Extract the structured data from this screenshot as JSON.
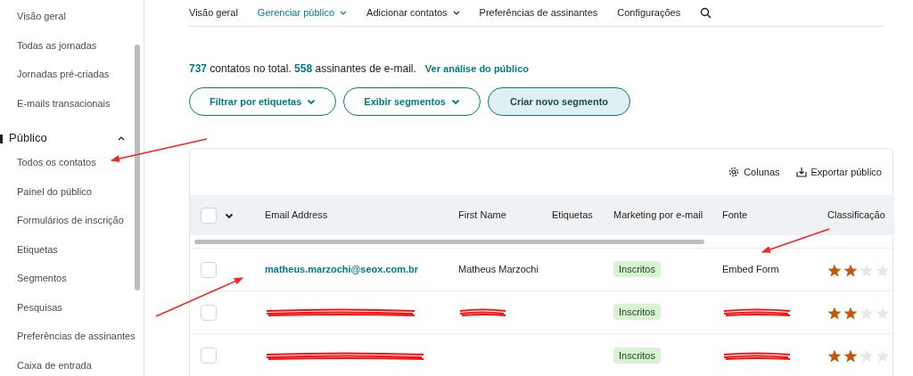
{
  "sidebar": {
    "items": [
      {
        "label": "Visão geral",
        "selected": false
      },
      {
        "label": "Todas as jornadas",
        "selected": false
      },
      {
        "label": "Jornadas pré-criadas",
        "selected": false
      },
      {
        "label": "E-mails transacionais",
        "selected": false
      }
    ],
    "section": {
      "label": "Público",
      "expanded": true,
      "items": [
        {
          "label": "Todos os contatos",
          "selected": false
        },
        {
          "label": "Painel do público",
          "selected": false
        },
        {
          "label": "Formulários de inscrição",
          "selected": false
        },
        {
          "label": "Etiquetas",
          "selected": false
        },
        {
          "label": "Segmentos",
          "selected": false
        },
        {
          "label": "Pesquisas",
          "selected": false
        },
        {
          "label": "Preferências de assinantes",
          "selected": false
        },
        {
          "label": "Caixa de entrada",
          "selected": false
        }
      ]
    }
  },
  "tabs": [
    {
      "label": "Visão geral",
      "selected": false,
      "dropdown": false
    },
    {
      "label": "Gerenciar público",
      "selected": true,
      "dropdown": true
    },
    {
      "label": "Adicionar contatos",
      "selected": false,
      "dropdown": true
    },
    {
      "label": "Preferências de assinantes",
      "selected": false,
      "dropdown": false
    },
    {
      "label": "Configurações",
      "selected": false,
      "dropdown": false
    }
  ],
  "summary": {
    "contacts_count": "737",
    "contacts_text": "contatos no total.",
    "subscribers_count": "558",
    "subscribers_text": "assinantes de e-mail.",
    "link": "Ver análise do público"
  },
  "buttons": [
    {
      "label": "Filtrar por etiquetas",
      "dropdown": true,
      "primary": false
    },
    {
      "label": "Exibir segmentos",
      "dropdown": true,
      "primary": false
    },
    {
      "label": "Criar novo segmento",
      "dropdown": false,
      "primary": true
    }
  ],
  "toolbar": [
    {
      "label": "Colunas",
      "kind": "gear"
    },
    {
      "label": "Exportar público",
      "kind": "download"
    }
  ],
  "table": {
    "select_all": {
      "checked": false
    },
    "columns": [
      "Email Address",
      "First Name",
      "Etiquetas",
      "Marketing por e-mail",
      "Fonte",
      "Classificação"
    ],
    "rows": [
      {
        "selected": false,
        "email": {
          "kind": "text",
          "text": "matheus.marzochi@seox.com.br"
        },
        "first_name": {
          "kind": "text",
          "text": "Matheus Marzochi"
        },
        "status": "Inscritos",
        "source": {
          "kind": "text",
          "text": "Embed Form"
        },
        "stars": 2
      },
      {
        "selected": false,
        "email": {
          "kind": "redacted"
        },
        "first_name": {
          "kind": "redacted"
        },
        "status": "Inscritos",
        "source": {
          "kind": "redacted"
        },
        "stars": 2
      },
      {
        "selected": false,
        "email": {
          "kind": "redacted"
        },
        "status": "Inscritos",
        "source": {
          "kind": "redacted"
        },
        "stars": 2
      }
    ]
  }
}
